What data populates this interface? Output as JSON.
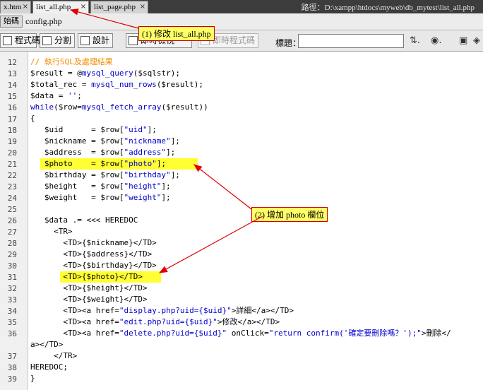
{
  "tabs": [
    {
      "label": "x.htm",
      "active": false
    },
    {
      "label": "list_all.php",
      "active": true
    },
    {
      "label": "list_page.php",
      "active": false
    }
  ],
  "path": "路徑：D:\\xampp\\htdocs\\myweb\\db_mytest\\list_all.php",
  "related": {
    "source": "始碼",
    "file": "config.php"
  },
  "toolbar": {
    "code": "程式碼",
    "split": "分割",
    "design": "設計",
    "live_view": "即時檢視",
    "live_code": "即時程式碼",
    "title_label": "標題：",
    "title_value": ""
  },
  "lines": [
    {
      "num": "12",
      "text": "// 執行SQL及處理結果"
    },
    {
      "num": "13",
      "text": "$result = @mysql_query($sqlstr);"
    },
    {
      "num": "14",
      "text": "$total_rec = mysql_num_rows($result);"
    },
    {
      "num": "15",
      "text": "$data = '';"
    },
    {
      "num": "16",
      "text": "while($row=mysql_fetch_array($result))"
    },
    {
      "num": "17",
      "text": "{"
    },
    {
      "num": "18",
      "text": "   $uid      = $row[\"uid\"];"
    },
    {
      "num": "19",
      "text": "   $nickname = $row[\"nickname\"];"
    },
    {
      "num": "20",
      "text": "   $address  = $row[\"address\"];"
    },
    {
      "num": "21",
      "text": "   $photo    = $row[\"photo\"];"
    },
    {
      "num": "22",
      "text": "   $birthday = $row[\"birthday\"];"
    },
    {
      "num": "23",
      "text": "   $height   = $row[\"height\"];"
    },
    {
      "num": "24",
      "text": "   $weight   = $row[\"weight\"];"
    },
    {
      "num": "25",
      "text": ""
    },
    {
      "num": "26",
      "text": "   $data .= <<< HEREDOC"
    },
    {
      "num": "27",
      "text": "     <TR>"
    },
    {
      "num": "28",
      "text": "       <TD>{$nickname}</TD>"
    },
    {
      "num": "29",
      "text": "       <TD>{$address}</TD>"
    },
    {
      "num": "30",
      "text": "       <TD>{$birthday}</TD>"
    },
    {
      "num": "31",
      "text": "       <TD>{$photo}</TD>"
    },
    {
      "num": "32",
      "text": "       <TD>{$height}</TD>"
    },
    {
      "num": "33",
      "text": "       <TD>{$weight}</TD>"
    },
    {
      "num": "34",
      "text": "       <TD><a href=\"display.php?uid={$uid}\">詳細</a></TD>"
    },
    {
      "num": "35",
      "text": "       <TD><a href=\"edit.php?uid={$uid}\">修改</a></TD>"
    },
    {
      "num": "36",
      "text": "       <TD><a href=\"delete.php?uid={$uid}\" onClick=\"return confirm('確定要刪除嗎？');\">刪除</"
    },
    {
      "num": "",
      "text": "a></TD>"
    },
    {
      "num": "37",
      "text": "     </TR>"
    },
    {
      "num": "38",
      "text": "HEREDOC;"
    },
    {
      "num": "39",
      "text": "}"
    }
  ],
  "annotations": {
    "note1": "(1) 修改 list_all.php",
    "note2": "(2) 增加 photo 欄位"
  },
  "colors": {
    "highlight": "#ffff33",
    "arrow": "#e00000",
    "comment": "#f28c00",
    "keyword": "#0000cc"
  }
}
